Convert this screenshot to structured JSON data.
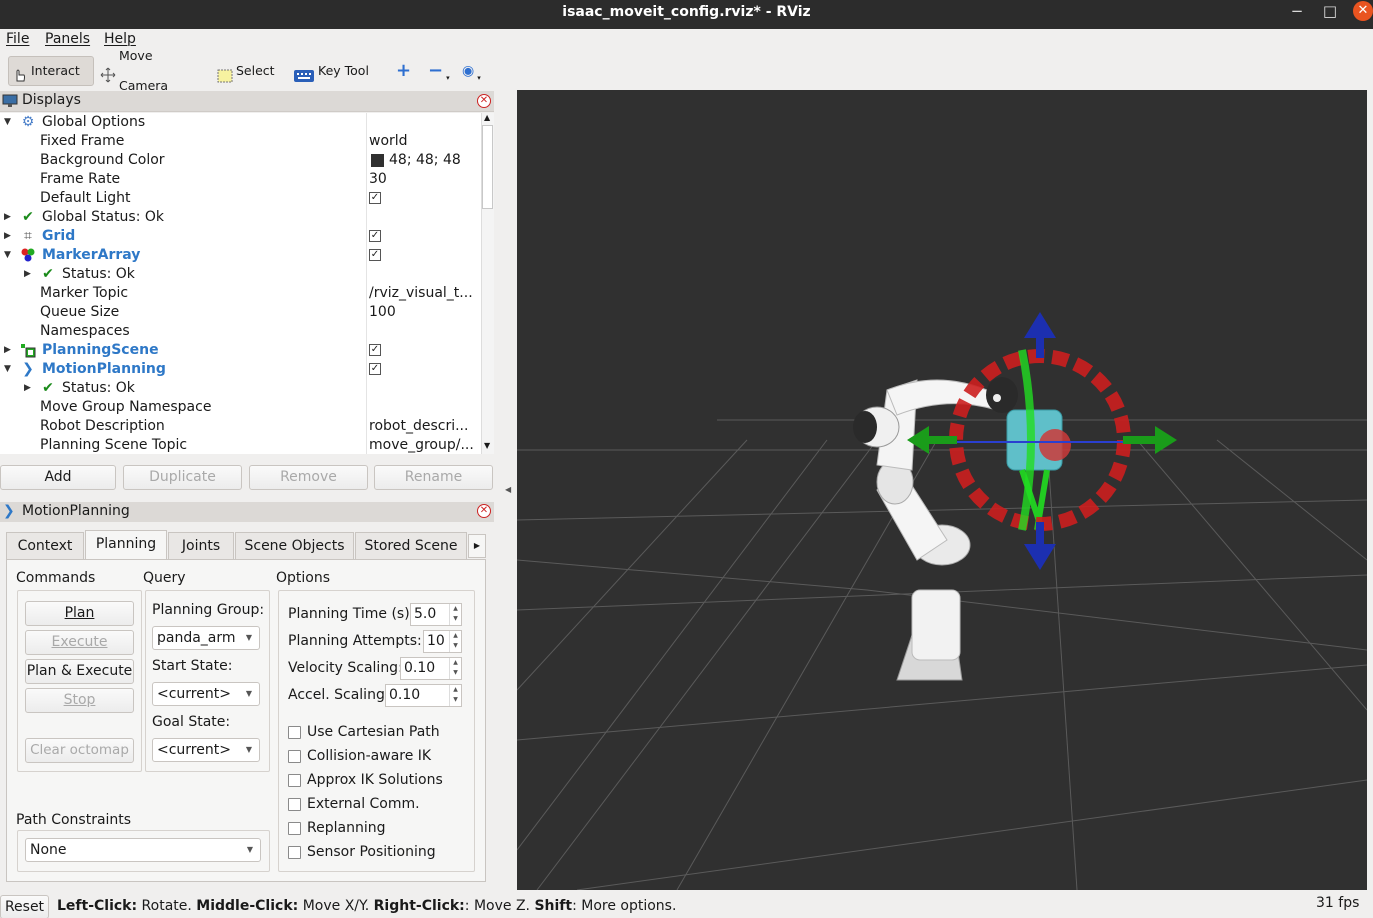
{
  "window": {
    "title": "isaac_moveit_config.rviz* - RViz",
    "minimize": "−",
    "maximize": "□",
    "close": "✕"
  },
  "menu": {
    "file": "File",
    "panels": "Panels",
    "help": "Help"
  },
  "toolbar": {
    "interact": "Interact",
    "move_camera": "Move Camera",
    "select": "Select",
    "key_tool": "Key Tool"
  },
  "displays": {
    "title": "Displays",
    "rows": [
      {
        "label": "Global Options"
      },
      {
        "label": "Fixed Frame",
        "value": "world"
      },
      {
        "label": "Background Color",
        "value": "48; 48; 48"
      },
      {
        "label": "Frame Rate",
        "value": "30"
      },
      {
        "label": "Default Light"
      },
      {
        "label": "Global Status: Ok"
      },
      {
        "label": "Grid"
      },
      {
        "label": "MarkerArray"
      },
      {
        "label": "Status: Ok"
      },
      {
        "label": "Marker Topic",
        "value": "/rviz_visual_t..."
      },
      {
        "label": "Queue Size",
        "value": "100"
      },
      {
        "label": "Namespaces"
      },
      {
        "label": "PlanningScene"
      },
      {
        "label": "MotionPlanning"
      },
      {
        "label": "Status: Ok"
      },
      {
        "label": "Move Group Namespace"
      },
      {
        "label": "Robot Description",
        "value": "robot_descri..."
      },
      {
        "label": "Planning Scene Topic",
        "value": "move_group/..."
      }
    ],
    "buttons": {
      "add": "Add",
      "duplicate": "Duplicate",
      "remove": "Remove",
      "rename": "Rename"
    }
  },
  "motion_planning": {
    "title": "MotionPlanning",
    "tabs": [
      "Context",
      "Planning",
      "Joints",
      "Scene Objects",
      "Stored Scene"
    ],
    "commands": {
      "title": "Commands",
      "plan": "Plan",
      "execute": "Execute",
      "plan_execute": "Plan & Execute",
      "stop": "Stop",
      "clear_octomap": "Clear octomap"
    },
    "query": {
      "title": "Query",
      "planning_group_label": "Planning Group:",
      "planning_group": "panda_arm",
      "start_state_label": "Start State:",
      "start_state": "<current>",
      "goal_state_label": "Goal State:",
      "goal_state": "<current>"
    },
    "options": {
      "title": "Options",
      "planning_time_label": "Planning Time (s):",
      "planning_time": "5.0",
      "planning_attempts_label": "Planning Attempts:",
      "planning_attempts": "10",
      "velocity_scaling_label": "Velocity Scaling:",
      "velocity_scaling": "0.10",
      "accel_scaling_label": "Accel. Scaling:",
      "accel_scaling": "0.10",
      "checkboxes": [
        "Use Cartesian Path",
        "Collision-aware IK",
        "Approx IK Solutions",
        "External Comm.",
        "Replanning",
        "Sensor Positioning"
      ]
    },
    "path_constraints": {
      "title": "Path Constraints",
      "value": "None"
    }
  },
  "status": {
    "reset": "Reset",
    "left_click_key": "Left-Click:",
    "left_click": " Rotate. ",
    "middle_click_key": "Middle-Click:",
    "middle_click": " Move X/Y. ",
    "right_click_key": "Right-Click:",
    "right_click": ": Move Z. ",
    "shift_key": "Shift",
    "shift": ": More options.",
    "fps": "31 fps"
  },
  "colors": {
    "background": "#303030",
    "accent_link": "#2e78c7",
    "ring": "#cc1f1f",
    "arrow_green": "#1a9c1a",
    "arrow_blue": "#1c2fb0"
  }
}
